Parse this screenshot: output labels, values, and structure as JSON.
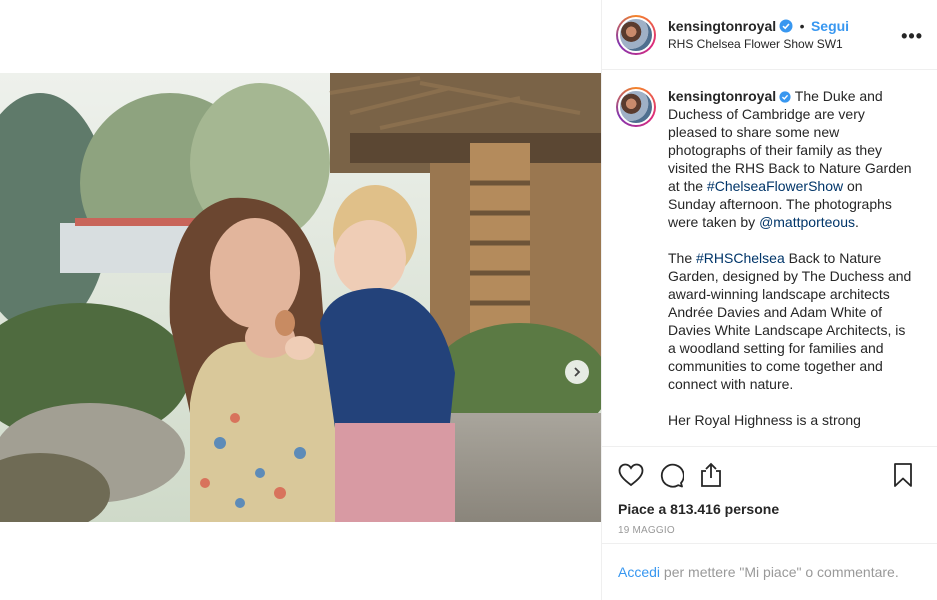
{
  "post": {
    "username": "kensingtonroyal",
    "follow_label": "Segui",
    "separator": "•",
    "location": "RHS Chelsea Flower Show SW1",
    "more_label": "•••"
  },
  "caption": {
    "username": "kensingtonroyal",
    "p1_text1": " The Duke and Duchess of Cambridge are very pleased to share some new photographs of their family as they visited the RHS Back to Nature Garden at the ",
    "p1_tag1": "#ChelseaFlowerShow",
    "p1_text2": " on Sunday afternoon. The photographs were taken by ",
    "p1_tag2": "@mattporteous",
    "p1_text3": ".",
    "p2_text1": "The ",
    "p2_tag1": "#RHSChelsea",
    "p2_text2": " Back to Nature Garden, designed by The Duchess and award-winning landscape architects Andrée Davies and Adam White of Davies White Landscape Architects, is a woodland setting for families and communities to come together and connect with nature.",
    "p3_text": "Her Royal Highness is a strong"
  },
  "actions": {
    "likes": "Piace a 813.416 persone",
    "date": "19 MAGGIO"
  },
  "login": {
    "link": "Accedi",
    "text": " per mettere \"Mi piace\" o commentare."
  },
  "icons": {
    "like": "heart-icon",
    "comment": "comment-icon",
    "share": "share-icon",
    "save": "bookmark-icon",
    "verified": "verified-badge-icon",
    "next": "chevron-right-icon"
  },
  "colors": {
    "link": "#3897f0",
    "hashtag": "#003569",
    "verified": "#3897f0"
  }
}
